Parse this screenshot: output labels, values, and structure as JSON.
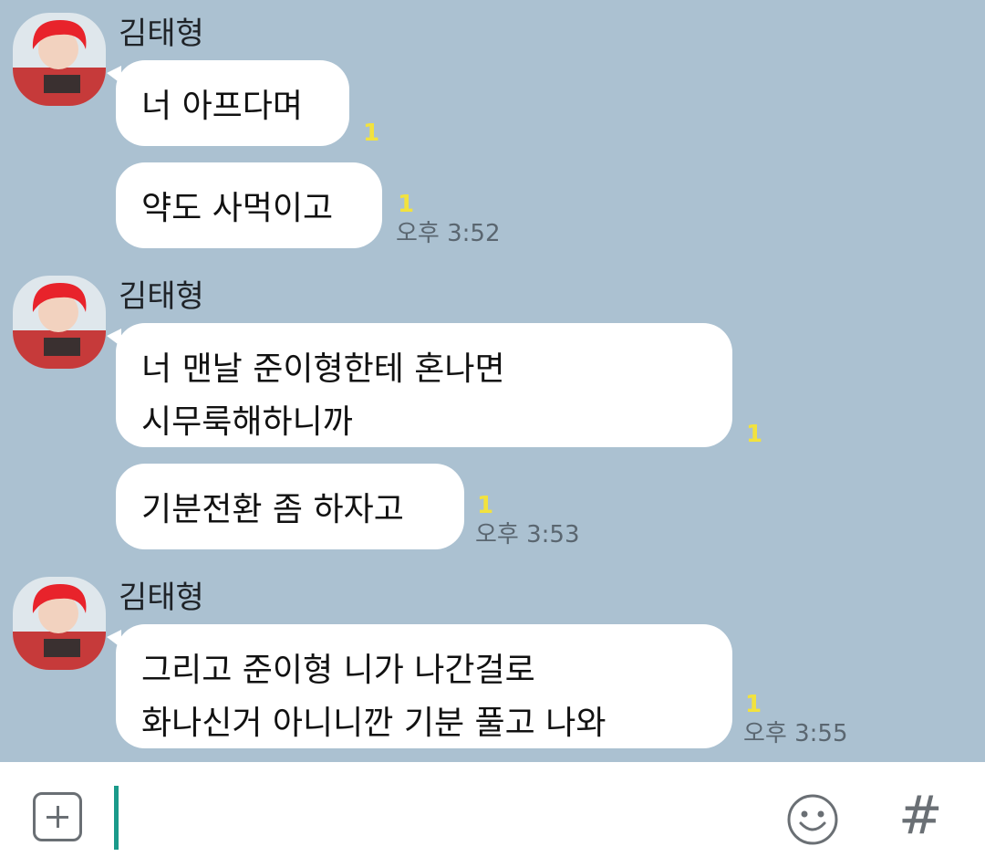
{
  "contact": {
    "name": "김태형"
  },
  "groups": [
    {
      "name": "김태형",
      "messages": [
        {
          "lines": [
            "너 아프다며"
          ],
          "unread": "1",
          "time": ""
        },
        {
          "lines": [
            "약도 사먹이고"
          ],
          "unread": "1",
          "time": "오후 3:52"
        }
      ]
    },
    {
      "name": "김태형",
      "messages": [
        {
          "lines": [
            "너 맨날 준이형한테 혼나면",
            "시무룩해하니까"
          ],
          "unread": "1",
          "time": ""
        },
        {
          "lines": [
            "기분전환 좀 하자고"
          ],
          "unread": "1",
          "time": "오후 3:53"
        }
      ]
    },
    {
      "name": "김태형",
      "messages": [
        {
          "lines": [
            "그리고 준이형 니가 나간걸로",
            "화나신거 아니니깐 기분 풀고 나와"
          ],
          "unread": "1",
          "time": "오후 3:55"
        }
      ]
    }
  ],
  "input": {
    "value": "",
    "icons": {
      "attach": "plus-square-icon",
      "emoji": "smiley-icon",
      "hashtag": "hash-icon"
    },
    "hashtag_symbol": "#"
  },
  "colors": {
    "chat_background": "#abc1d1",
    "bubble": "#ffffff",
    "unread": "#f2e23e",
    "cursor": "#1a9a8a"
  }
}
